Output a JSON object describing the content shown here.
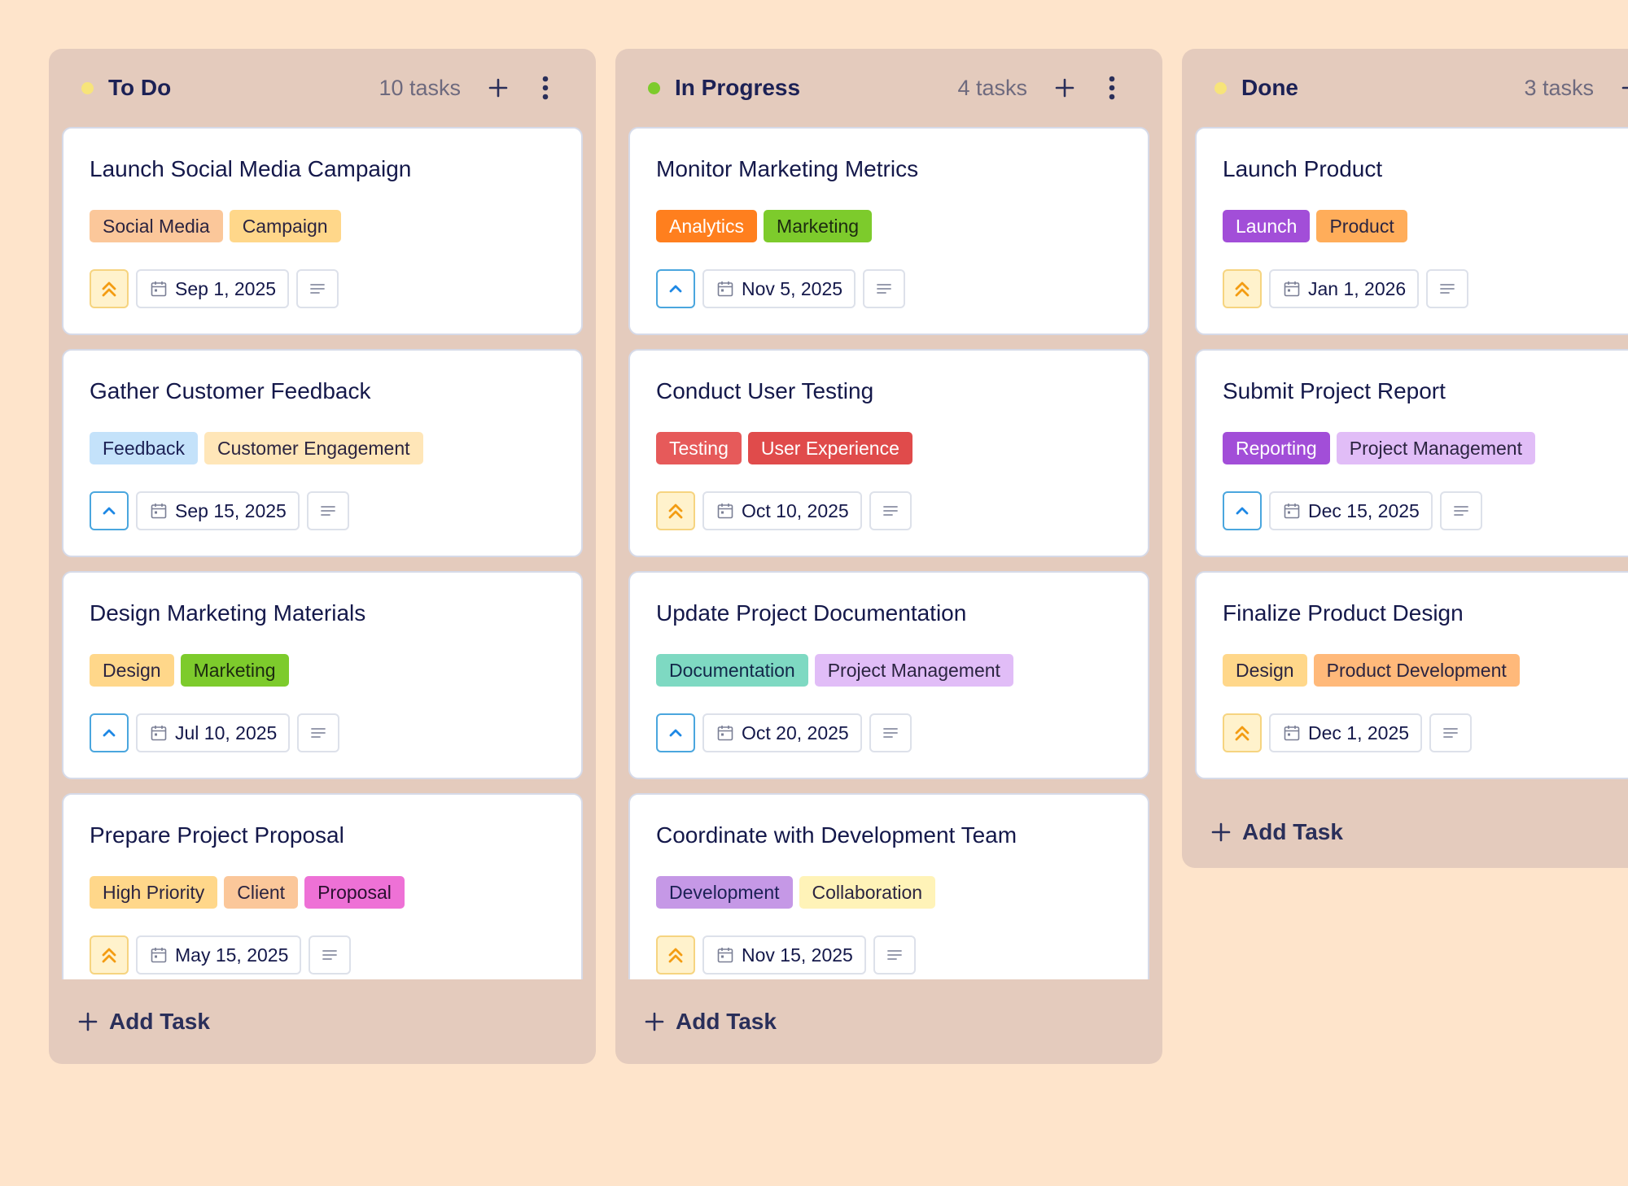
{
  "columns": [
    {
      "title": "To Do",
      "count": "10 tasks",
      "dot_color": "#F7E47A",
      "add_task_label": "Add Task",
      "cards": [
        {
          "title": "Launch Social Media Campaign",
          "tags": [
            {
              "label": "Social Media",
              "bg": "#FBC79A",
              "fg": "#2B2440"
            },
            {
              "label": "Campaign",
              "bg": "#FFD78A",
              "fg": "#2B2440"
            }
          ],
          "priority": "high",
          "date": "Sep 1, 2025"
        },
        {
          "title": "Gather Customer Feedback",
          "tags": [
            {
              "label": "Feedback",
              "bg": "#C4E2FA",
              "fg": "#1C2155"
            },
            {
              "label": "Customer Engagement",
              "bg": "#FFE6B8",
              "fg": "#2B2440"
            }
          ],
          "priority": "medium",
          "date": "Sep 15, 2025"
        },
        {
          "title": "Design Marketing Materials",
          "tags": [
            {
              "label": "Design",
              "bg": "#FFD78A",
              "fg": "#2B2440"
            },
            {
              "label": "Marketing",
              "bg": "#7DCB2C",
              "fg": "#1C2A10"
            }
          ],
          "priority": "medium",
          "date": "Jul 10, 2025"
        },
        {
          "title": "Prepare Project Proposal",
          "tags": [
            {
              "label": "High Priority",
              "bg": "#FFD78A",
              "fg": "#2B2440"
            },
            {
              "label": "Client",
              "bg": "#FBC79A",
              "fg": "#2B2440"
            },
            {
              "label": "Proposal",
              "bg": "#EE71D6",
              "fg": "#2B1030"
            }
          ],
          "priority": "high",
          "date": "May 15, 2025"
        }
      ]
    },
    {
      "title": "In Progress",
      "count": "4 tasks",
      "dot_color": "#7DCB2C",
      "add_task_label": "Add Task",
      "cards": [
        {
          "title": "Monitor Marketing Metrics",
          "tags": [
            {
              "label": "Analytics",
              "bg": "#FF7F1E",
              "fg": "#FFFFFF"
            },
            {
              "label": "Marketing",
              "bg": "#7DCB2C",
              "fg": "#1C2A10"
            }
          ],
          "priority": "medium",
          "date": "Nov 5, 2025"
        },
        {
          "title": "Conduct User Testing",
          "tags": [
            {
              "label": "Testing",
              "bg": "#E65A5A",
              "fg": "#FFFFFF"
            },
            {
              "label": "User Experience",
              "bg": "#E04B4B",
              "fg": "#FFFFFF"
            }
          ],
          "priority": "high",
          "date": "Oct 10, 2025"
        },
        {
          "title": "Update Project Documentation",
          "tags": [
            {
              "label": "Documentation",
              "bg": "#7ED9C2",
              "fg": "#13284A"
            },
            {
              "label": "Project Management",
              "bg": "#E1BDF7",
              "fg": "#2B2440"
            }
          ],
          "priority": "medium",
          "date": "Oct 20, 2025"
        },
        {
          "title": "Coordinate with Development Team",
          "tags": [
            {
              "label": "Development",
              "bg": "#C598E6",
              "fg": "#1C2155"
            },
            {
              "label": "Collaboration",
              "bg": "#FFF3B8",
              "fg": "#2B2440"
            }
          ],
          "priority": "high",
          "date": "Nov 15, 2025"
        }
      ]
    },
    {
      "title": "Done",
      "count": "3 tasks",
      "dot_color": "#F7E47A",
      "add_task_label": "Add Task",
      "cards": [
        {
          "title": "Launch Product",
          "tags": [
            {
              "label": "Launch",
              "bg": "#A24ED8",
              "fg": "#FFFFFF"
            },
            {
              "label": "Product",
              "bg": "#FFAD5A",
              "fg": "#2B2440"
            }
          ],
          "priority": "high",
          "date": "Jan 1, 2026"
        },
        {
          "title": "Submit Project Report",
          "tags": [
            {
              "label": "Reporting",
              "bg": "#A24ED8",
              "fg": "#FFFFFF"
            },
            {
              "label": "Project Management",
              "bg": "#E1BDF7",
              "fg": "#2B2440"
            }
          ],
          "priority": "medium",
          "date": "Dec 15, 2025"
        },
        {
          "title": "Finalize Product Design",
          "tags": [
            {
              "label": "Design",
              "bg": "#FFD78A",
              "fg": "#2B2440"
            },
            {
              "label": "Product Development",
              "bg": "#FFB97A",
              "fg": "#2B2440"
            }
          ],
          "priority": "high",
          "date": "Dec 1, 2025"
        }
      ]
    }
  ],
  "colors": {
    "page_bg": "#FEE4CB",
    "column_bg": "#E4CBBD",
    "card_bg": "#FFFFFF",
    "priority_high": "#F39C12",
    "priority_medium": "#1E88E5"
  },
  "icons": {
    "add": "plus-icon",
    "menu": "vertical-dots-icon",
    "priority_high": "double-chevron-up-icon",
    "priority_medium": "chevron-up-icon",
    "date": "calendar-icon",
    "notes": "lines-icon"
  }
}
